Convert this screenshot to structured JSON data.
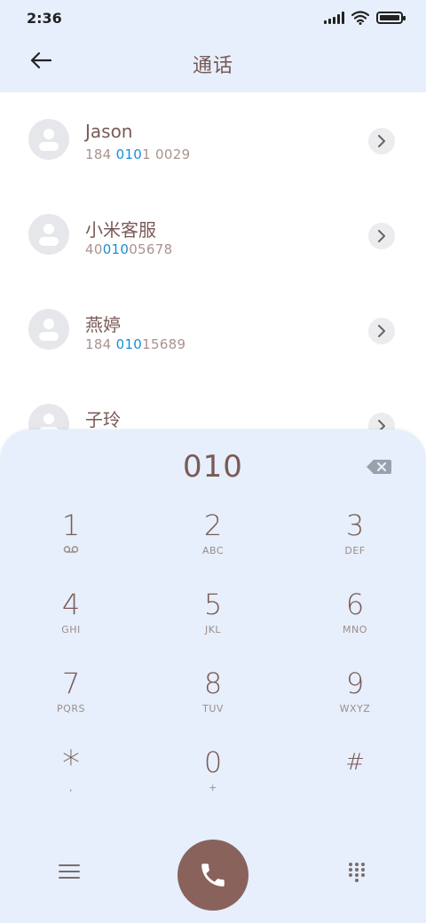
{
  "status": {
    "time": "2:36"
  },
  "header": {
    "title": "通话",
    "back_icon": "arrow-left-icon"
  },
  "contacts": [
    {
      "name": "Jason",
      "number_pre": "184 ",
      "number_hl": "010",
      "number_post": "1 0029"
    },
    {
      "name": "小米客服",
      "number_pre": "40",
      "number_hl": "010",
      "number_post": "05678"
    },
    {
      "name": "燕婷",
      "number_pre": "184 ",
      "number_hl": "010",
      "number_post": "15689"
    },
    {
      "name": "子玲",
      "number_pre": "",
      "number_hl": "",
      "number_post": ""
    }
  ],
  "dialpad": {
    "dialed_number": "010",
    "keys": [
      {
        "digit": "1",
        "sub": ""
      },
      {
        "digit": "2",
        "sub": "ABC"
      },
      {
        "digit": "3",
        "sub": "DEF"
      },
      {
        "digit": "4",
        "sub": "GHI"
      },
      {
        "digit": "5",
        "sub": "JKL"
      },
      {
        "digit": "6",
        "sub": "MNO"
      },
      {
        "digit": "7",
        "sub": "PQRS"
      },
      {
        "digit": "8",
        "sub": "TUV"
      },
      {
        "digit": "9",
        "sub": "WXYZ"
      },
      {
        "digit": "*",
        "sub": ","
      },
      {
        "digit": "0",
        "sub": "+"
      },
      {
        "digit": "#",
        "sub": ""
      }
    ]
  },
  "colors": {
    "accent": "#7a5a56",
    "highlight": "#1a8fd6",
    "call_button": "#8a625c",
    "sheet_background": "#e6effb"
  }
}
